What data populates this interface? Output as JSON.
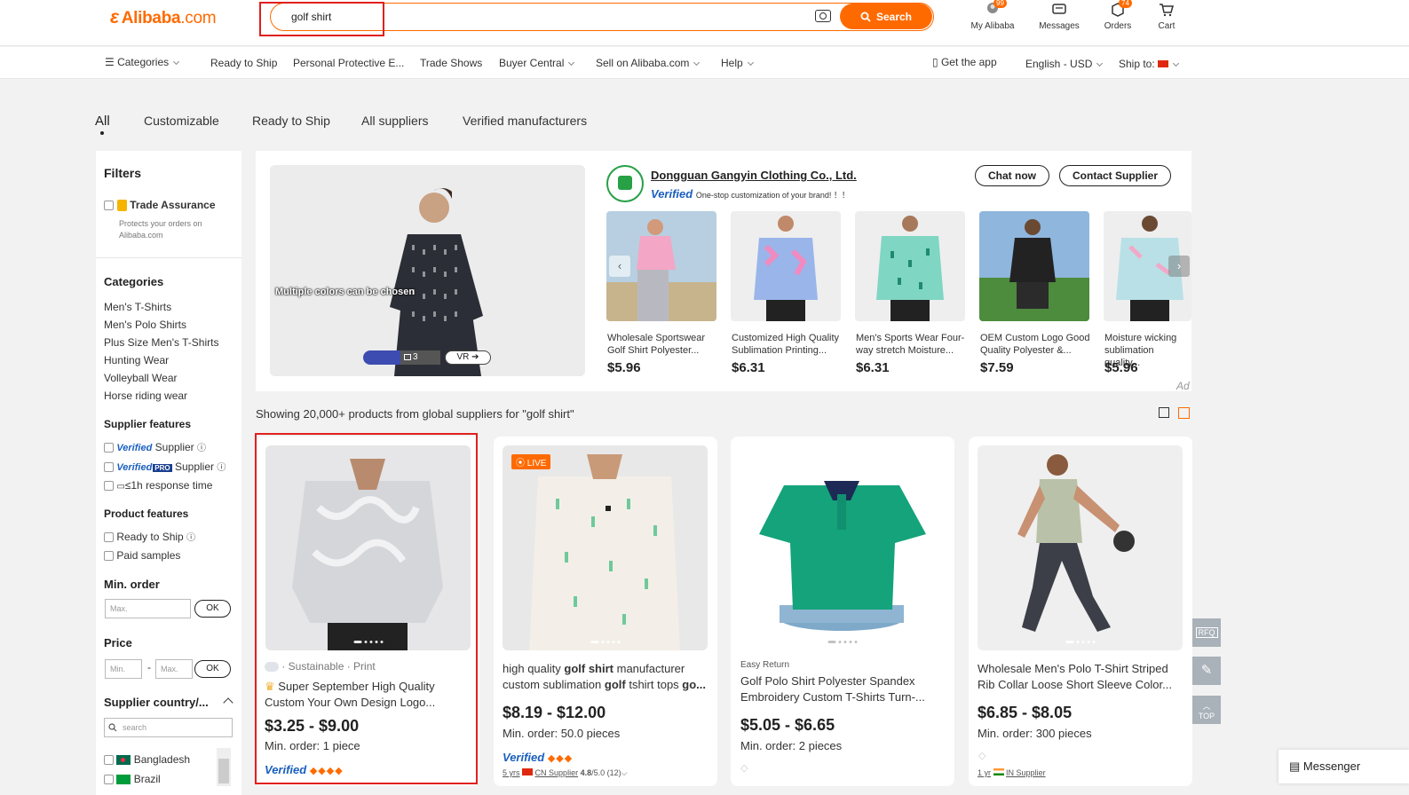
{
  "header": {
    "logo_mark": "ε",
    "logo_text": "Alibaba",
    "logo_suffix": ".com",
    "search_value": "golf shirt",
    "search_button": "Search",
    "my_alibaba": "My Alibaba",
    "my_alibaba_badge": "99",
    "messages": "Messages",
    "orders": "Orders",
    "orders_badge": "74",
    "cart": "Cart"
  },
  "nav": {
    "categories": "Categories",
    "ready_to_ship": "Ready to Ship",
    "ppe": "Personal Protective E...",
    "trade_shows": "Trade Shows",
    "buyer_central": "Buyer Central",
    "sell": "Sell on Alibaba.com",
    "help": "Help",
    "get_app": "Get the app",
    "language": "English - USD",
    "ship_to": "Ship to:"
  },
  "tabs": [
    "All",
    "Customizable",
    "Ready to Ship",
    "All suppliers",
    "Verified manufacturers"
  ],
  "sidebar": {
    "filters": "Filters",
    "trade_assurance": "Trade Assurance",
    "trade_assurance_note": "Protects your orders on Alibaba.com",
    "categories_title": "Categories",
    "categories": [
      "Men's T-Shirts",
      "Men's Polo Shirts",
      "Plus Size Men's T-Shirts",
      "Hunting Wear",
      "Volleyball Wear",
      "Horse riding wear"
    ],
    "supplier_features": "Supplier features",
    "sf_verified": "Verified",
    "sf_supplier": "Supplier",
    "sf_verified_pro": "Verified",
    "sf_pro": "PRO",
    "sf_pro_supplier": "Supplier",
    "sf_response": "≤1h response time",
    "product_features": "Product features",
    "pf_ready": "Ready to Ship",
    "pf_samples": "Paid samples",
    "min_order": "Min. order",
    "max_placeholder": "Max.",
    "ok": "OK",
    "price": "Price",
    "min_price": "Min.",
    "dash": "-",
    "max_price": "Max.",
    "supplier_country": "Supplier country/...",
    "country_search": "search",
    "countries": [
      "Bangladesh",
      "Brazil"
    ]
  },
  "ad": {
    "image_caption": "Multiple colors can be chosen",
    "image_count": "3",
    "vr": "VR",
    "company": "Dongguan Gangyin Clothing Co., Ltd.",
    "verified": "Verified",
    "tagline": "One-stop customization of your brand!  ！！",
    "chat": "Chat now",
    "contact": "Contact Supplier",
    "ad_label": "Ad",
    "products": [
      {
        "title": "Wholesale Sportswear Golf Shirt Polyester...",
        "price": "$5.96"
      },
      {
        "title": "Customized High Quality Sublimation Printing...",
        "price": "$6.31"
      },
      {
        "title": "Men's Sports Wear Four-way stretch Moisture...",
        "price": "$6.31"
      },
      {
        "title": "OEM Custom Logo Good Quality Polyester &...",
        "price": "$7.59"
      },
      {
        "title": "Moisture wicking sublimation quality...",
        "price": "$5.96"
      }
    ]
  },
  "results": {
    "summary": "Showing 20,000+ products from global suppliers for \"golf shirt\"",
    "items": [
      {
        "tags": "· Sustainable · Print",
        "title": "Super September High Quality Custom Your Own Design Logo...",
        "price": "$3.25 - $9.00",
        "min": "Min. order: 1 piece",
        "verified": "Verified"
      },
      {
        "live": "LIVE",
        "title_a": "high quality ",
        "title_b": "golf shirt",
        "title_c": " manufacturer custom sublimation ",
        "title_d": "golf",
        "title_e": " tshirt tops ",
        "title_f": "go...",
        "price": "$8.19 - $12.00",
        "min": "Min. order: 50.0 pieces",
        "verified": "Verified",
        "years": "5 yrs",
        "country": "CN Supplier",
        "rating": "4.8",
        "rating_total": "/5.0 (12)"
      },
      {
        "tag": "Easy Return",
        "title_a": "Golf",
        " title_b": "",
        "title": "Golf Polo Shirt Polyester Spandex Embroidery Custom T-Shirts Turn-...",
        "price": "$5.05 - $6.65",
        "min": "Min. order: 2 pieces"
      },
      {
        "title": "Wholesale Men's Polo T-Shirt Striped Rib Collar Loose Short Sleeve Color...",
        "price": "$6.85 - $8.05",
        "min": "Min. order: 300 pieces",
        "years": "1 yr",
        "country": "IN Supplier"
      }
    ]
  },
  "side": {
    "rfq": "RFQ",
    "top": "TOP",
    "messenger": "Messenger"
  },
  "colors": {
    "accent": "#ff6a00",
    "verified": "#1a5fbf",
    "highlight": "#e0201e"
  }
}
